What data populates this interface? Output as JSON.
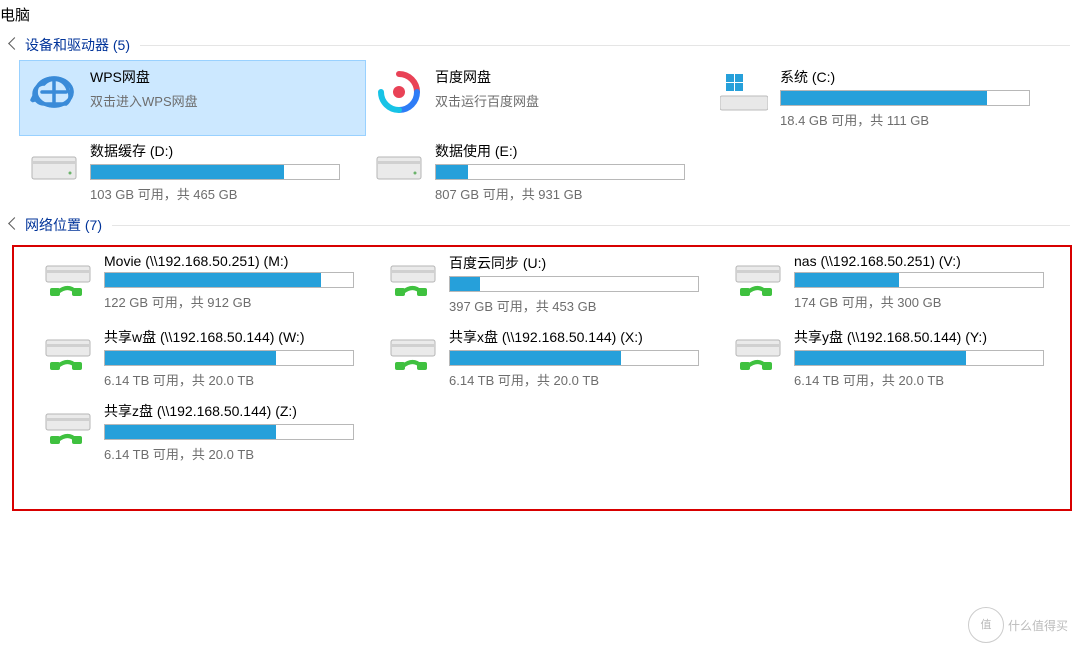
{
  "header": "电脑",
  "groups": {
    "devices": {
      "label": "设备和驱动器",
      "count": "(5)"
    },
    "network": {
      "label": "网络位置",
      "count": "(7)"
    }
  },
  "devices": [
    {
      "name": "WPS网盘",
      "sub": "双击进入WPS网盘",
      "icon": "wps",
      "selected": true
    },
    {
      "name": "百度网盘",
      "sub": "双击运行百度网盘",
      "icon": "baidu"
    },
    {
      "name": "系统 (C:)",
      "sub": "18.4 GB 可用，共 111 GB",
      "icon": "winlogo",
      "fill": 83,
      "bar": true
    },
    {
      "name": "数据缓存 (D:)",
      "sub": "103 GB 可用，共 465 GB",
      "icon": "drive",
      "fill": 78,
      "bar": true
    },
    {
      "name": "数据使用 (E:)",
      "sub": "807 GB 可用，共 931 GB",
      "icon": "drive",
      "fill": 13,
      "bar": true
    }
  ],
  "network": [
    {
      "name": "Movie (\\\\192.168.50.251) (M:)",
      "sub": "122 GB 可用，共 912 GB",
      "fill": 87
    },
    {
      "name": "百度云同步 (U:)",
      "sub": "397 GB 可用，共 453 GB",
      "fill": 12
    },
    {
      "name": "nas (\\\\192.168.50.251) (V:)",
      "sub": "174 GB 可用，共 300 GB",
      "fill": 42
    },
    {
      "name": "共享w盘 (\\\\192.168.50.144) (W:)",
      "sub": "6.14 TB 可用，共 20.0 TB",
      "fill": 69
    },
    {
      "name": "共享x盘 (\\\\192.168.50.144) (X:)",
      "sub": "6.14 TB 可用，共 20.0 TB",
      "fill": 69
    },
    {
      "name": "共享y盘 (\\\\192.168.50.144) (Y:)",
      "sub": "6.14 TB 可用，共 20.0 TB",
      "fill": 69
    },
    {
      "name": "共享z盘 (\\\\192.168.50.144) (Z:)",
      "sub": "6.14 TB 可用，共 20.0 TB",
      "fill": 69
    }
  ],
  "watermark": "什么值得买"
}
